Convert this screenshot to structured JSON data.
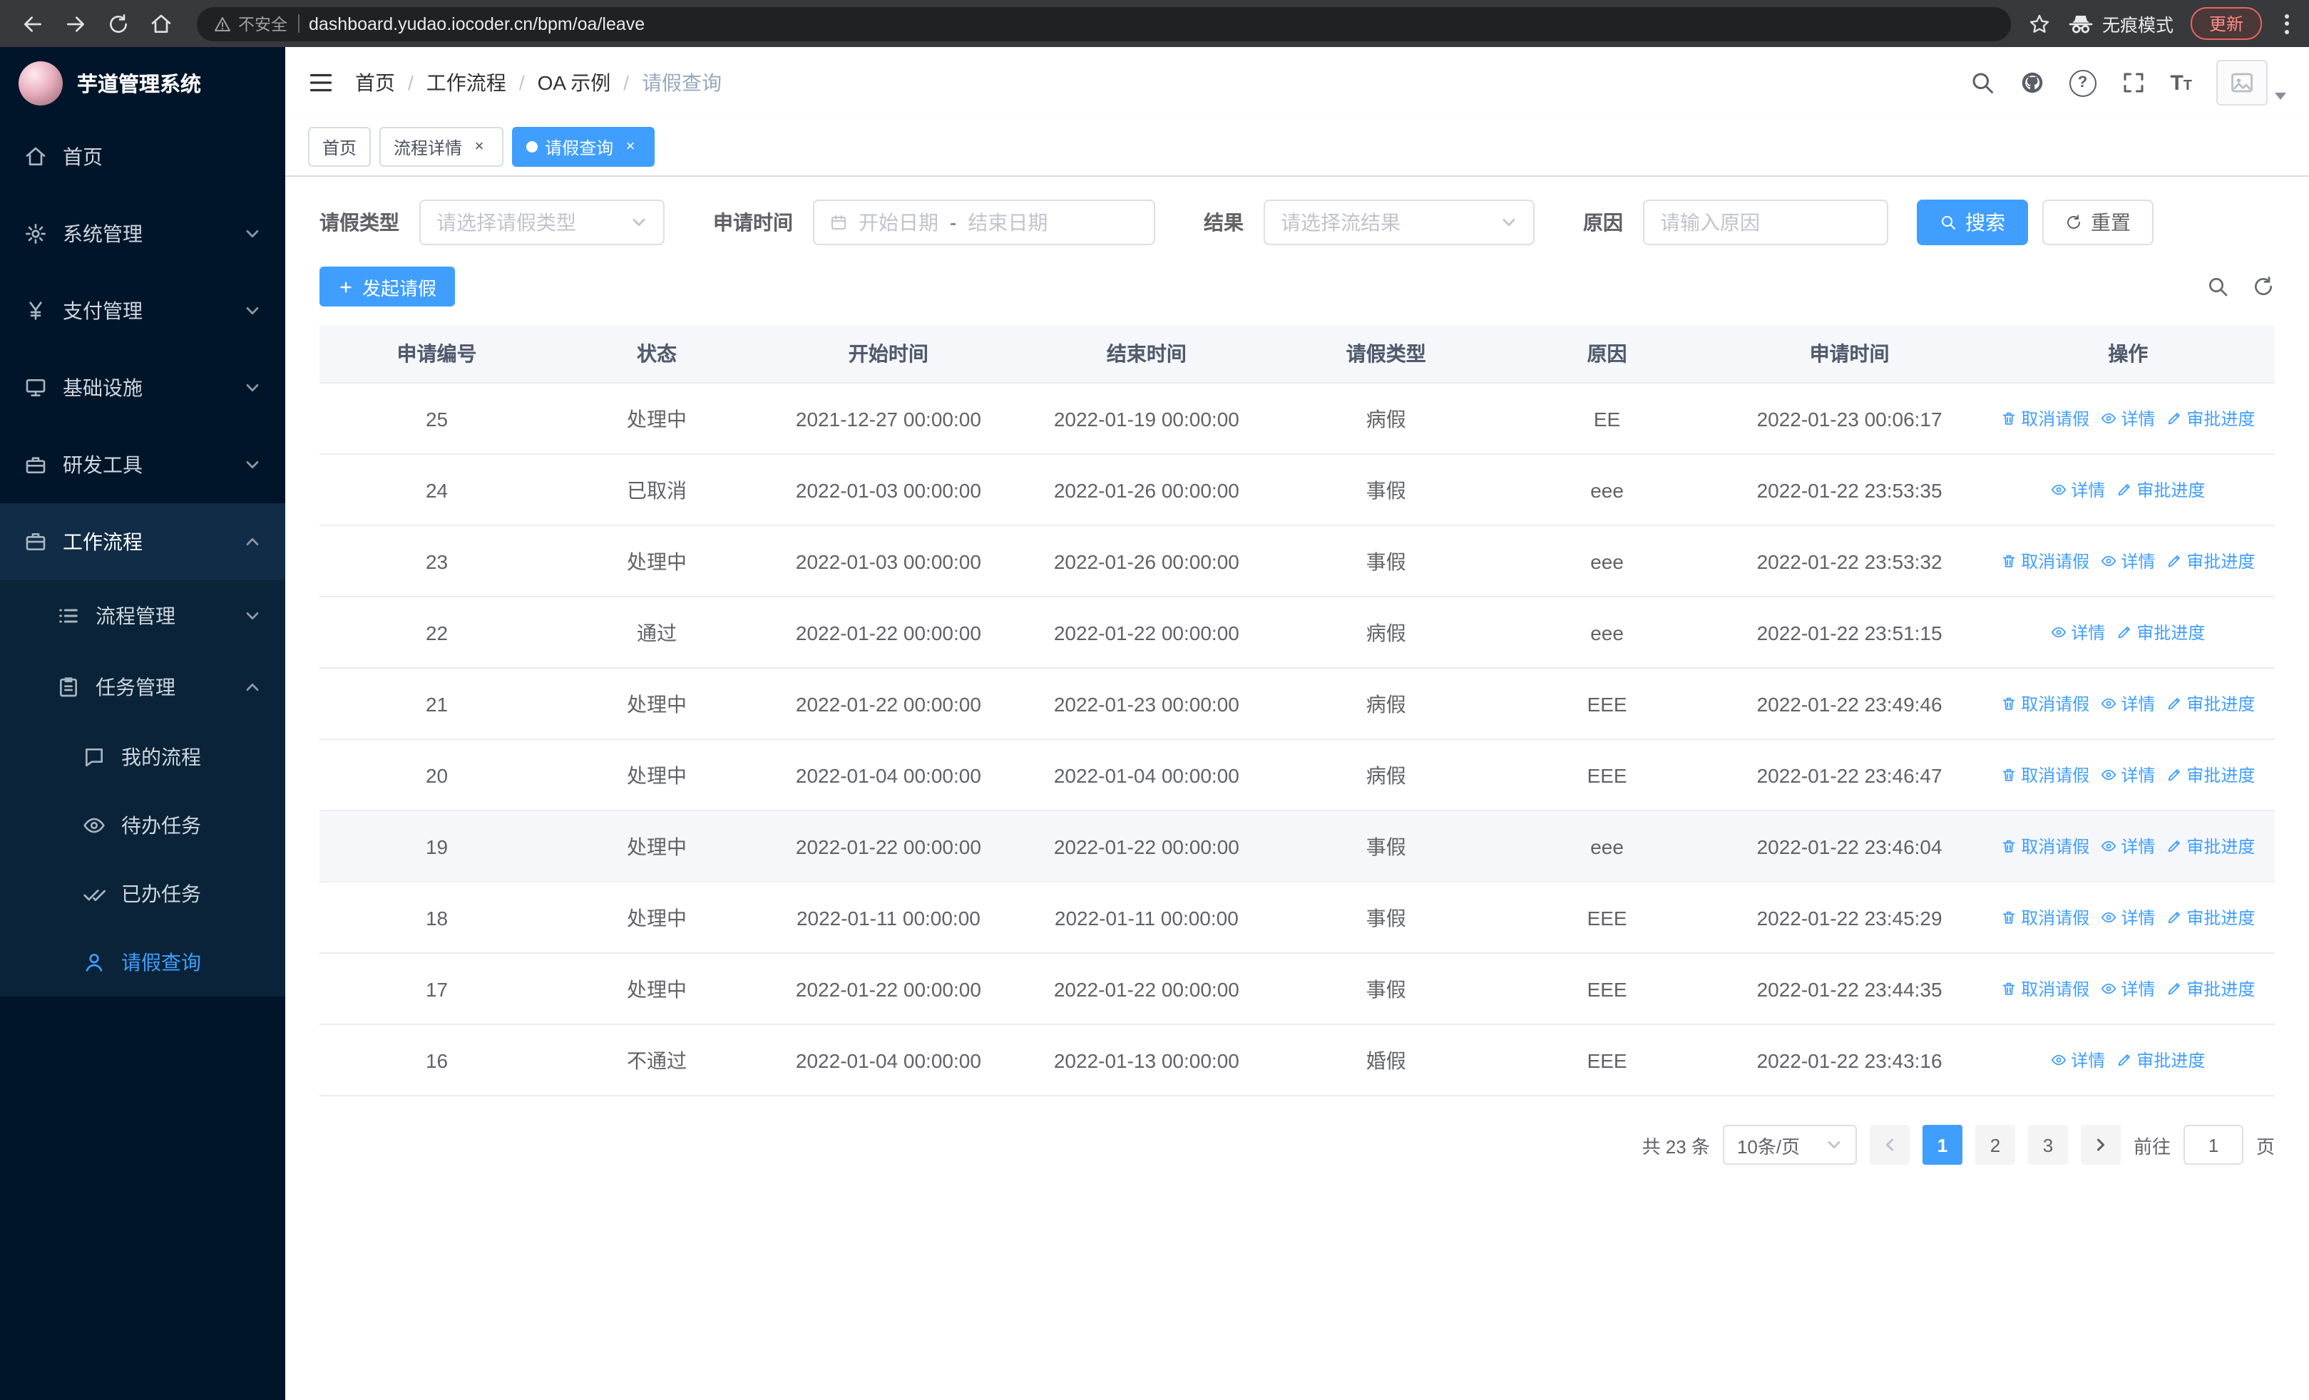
{
  "browser": {
    "security_label": "不安全",
    "url": "dashboard.yudao.iocoder.cn/bpm/oa/leave",
    "incognito_label": "无痕模式",
    "update_button": "更新"
  },
  "sidebar": {
    "app_title": "芋道管理系统",
    "items": [
      {
        "label": "首页"
      },
      {
        "label": "系统管理"
      },
      {
        "label": "支付管理"
      },
      {
        "label": "基础设施"
      },
      {
        "label": "研发工具"
      },
      {
        "label": "工作流程"
      }
    ],
    "workflow_children": [
      {
        "label": "流程管理"
      },
      {
        "label": "任务管理"
      }
    ],
    "task_children": [
      {
        "label": "我的流程"
      },
      {
        "label": "待办任务"
      },
      {
        "label": "已办任务"
      },
      {
        "label": "请假查询"
      }
    ]
  },
  "header": {
    "breadcrumb": [
      "首页",
      "工作流程",
      "OA 示例",
      "请假查询"
    ]
  },
  "tabs": [
    {
      "label": "首页"
    },
    {
      "label": "流程详情"
    },
    {
      "label": "请假查询"
    }
  ],
  "filters": {
    "leave_type_label": "请假类型",
    "leave_type_placeholder": "请选择请假类型",
    "apply_time_label": "申请时间",
    "start_date_placeholder": "开始日期",
    "range_separator": "-",
    "end_date_placeholder": "结束日期",
    "result_label": "结果",
    "result_placeholder": "请选择流结果",
    "reason_label": "原因",
    "reason_placeholder": "请输入原因",
    "search_button": "搜索",
    "reset_button": "重置"
  },
  "toolbar": {
    "create_button": "发起请假"
  },
  "table": {
    "columns": [
      "申请编号",
      "状态",
      "开始时间",
      "结束时间",
      "请假类型",
      "原因",
      "申请时间",
      "操作"
    ],
    "action_labels": {
      "cancel": "取消请假",
      "detail": "详情",
      "progress": "审批进度"
    },
    "rows": [
      {
        "id": "25",
        "status": "处理中",
        "start": "2021-12-27 00:00:00",
        "end": "2022-01-19 00:00:00",
        "type": "病假",
        "reason": "EE",
        "applied": "2022-01-23 00:06:17",
        "actions": [
          "cancel",
          "detail",
          "progress"
        ]
      },
      {
        "id": "24",
        "status": "已取消",
        "start": "2022-01-03 00:00:00",
        "end": "2022-01-26 00:00:00",
        "type": "事假",
        "reason": "eee",
        "applied": "2022-01-22 23:53:35",
        "actions": [
          "detail",
          "progress"
        ]
      },
      {
        "id": "23",
        "status": "处理中",
        "start": "2022-01-03 00:00:00",
        "end": "2022-01-26 00:00:00",
        "type": "事假",
        "reason": "eee",
        "applied": "2022-01-22 23:53:32",
        "actions": [
          "cancel",
          "detail",
          "progress"
        ]
      },
      {
        "id": "22",
        "status": "通过",
        "start": "2022-01-22 00:00:00",
        "end": "2022-01-22 00:00:00",
        "type": "病假",
        "reason": "eee",
        "applied": "2022-01-22 23:51:15",
        "actions": [
          "detail",
          "progress"
        ]
      },
      {
        "id": "21",
        "status": "处理中",
        "start": "2022-01-22 00:00:00",
        "end": "2022-01-23 00:00:00",
        "type": "病假",
        "reason": "EEE",
        "applied": "2022-01-22 23:49:46",
        "actions": [
          "cancel",
          "detail",
          "progress"
        ]
      },
      {
        "id": "20",
        "status": "处理中",
        "start": "2022-01-04 00:00:00",
        "end": "2022-01-04 00:00:00",
        "type": "病假",
        "reason": "EEE",
        "applied": "2022-01-22 23:46:47",
        "actions": [
          "cancel",
          "detail",
          "progress"
        ]
      },
      {
        "id": "19",
        "status": "处理中",
        "start": "2022-01-22 00:00:00",
        "end": "2022-01-22 00:00:00",
        "type": "事假",
        "reason": "eee",
        "applied": "2022-01-22 23:46:04",
        "actions": [
          "cancel",
          "detail",
          "progress"
        ],
        "highlight": true
      },
      {
        "id": "18",
        "status": "处理中",
        "start": "2022-01-11 00:00:00",
        "end": "2022-01-11 00:00:00",
        "type": "事假",
        "reason": "EEE",
        "applied": "2022-01-22 23:45:29",
        "actions": [
          "cancel",
          "detail",
          "progress"
        ]
      },
      {
        "id": "17",
        "status": "处理中",
        "start": "2022-01-22 00:00:00",
        "end": "2022-01-22 00:00:00",
        "type": "事假",
        "reason": "EEE",
        "applied": "2022-01-22 23:44:35",
        "actions": [
          "cancel",
          "detail",
          "progress"
        ]
      },
      {
        "id": "16",
        "status": "不通过",
        "start": "2022-01-04 00:00:00",
        "end": "2022-01-13 00:00:00",
        "type": "婚假",
        "reason": "EEE",
        "applied": "2022-01-22 23:43:16",
        "actions": [
          "detail",
          "progress"
        ]
      }
    ]
  },
  "pagination": {
    "total_text": "共 23 条",
    "page_size": "10条/页",
    "pages": [
      "1",
      "2",
      "3"
    ],
    "goto_label": "前往",
    "goto_value": "1",
    "unit_label": "页"
  },
  "colors": {
    "primary": "#409eff",
    "sidebar_bg": "#001529"
  }
}
